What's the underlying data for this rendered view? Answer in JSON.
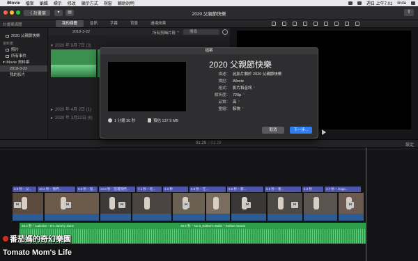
{
  "menubar": {
    "app": "iMovie",
    "items": [
      "檔案",
      "編輯",
      "標示",
      "修改",
      "顯示方式",
      "視窗",
      "輔助說明"
    ],
    "clock": "週日 上午7:01",
    "user": "linda"
  },
  "toolbar": {
    "back_label": "〈 計畫案",
    "window_title": "2020 父親節快樂"
  },
  "tabs": {
    "library_label": "計畫案媒體",
    "items": [
      "我的媒體",
      "音訊",
      "字幕",
      "背景",
      "過場效果"
    ],
    "active": "我的媒體"
  },
  "sidebar": {
    "items": [
      {
        "label": "2020 父親節快樂",
        "selected": false
      },
      {
        "label": "資料庫",
        "selected": false
      },
      {
        "label": "照片",
        "selected": false
      },
      {
        "label": "所有事件",
        "selected": false
      },
      {
        "label": "iMovie 資料庫",
        "selected": false
      },
      {
        "label": "2018-3-22",
        "selected": true
      },
      {
        "label": "我的影片",
        "selected": false
      }
    ]
  },
  "browser": {
    "current_event": "2018-3-22",
    "filter": "所有剪輯片段 ⌃",
    "search_placeholder": "搜尋",
    "events": [
      {
        "label": "2020 年 8月 7日 (3)"
      },
      {
        "label": "2020 年 4月 2日 (1)"
      },
      {
        "label": "2020 年 3月22日 (6)"
      }
    ]
  },
  "timeline": {
    "timecode": "01:29",
    "duration": "/ 01:29",
    "settings": "設定",
    "title_clips": [
      "3.9 秒 – 父...",
      "10.2 秒 – 我們...",
      "9.0 秒 – 陪...",
      "14.8 秒 – 陪著我們...",
      "7.1 秒 – 吃...",
      "4.0 秒",
      "6.8 秒 – 在...",
      "6.5 秒 – 那...",
      "5.9 秒 – 看...",
      "4.9 秒",
      "3.7 秒 – Happ..."
    ],
    "audio1": "48.2 秒 – Calimba – E's Jammy Jams",
    "audio2": "38.8 秒 – No.9_Esther's Waltz – Esther Abrami"
  },
  "dialog": {
    "title": "檔案",
    "project_name": "2020 父親節快樂",
    "rows": [
      {
        "key": "描述：",
        "value": "此影片關於 2020 父親節快樂",
        "select": false
      },
      {
        "key": "標記：",
        "value": "iMovie",
        "select": false
      },
      {
        "key": "格式：",
        "value": "影片和音訊",
        "select": true
      },
      {
        "key": "解析度：",
        "value": "720p",
        "select": true
      },
      {
        "key": "品質：",
        "value": "高",
        "select": true
      },
      {
        "key": "壓縮：",
        "value": "較快",
        "select": true
      }
    ],
    "duration": "1 分鐘 30 秒",
    "size": "預估 137.9 MB",
    "cancel_label": "取消",
    "next_label": "下一步..."
  },
  "watermark": {
    "line1": "番茄媽的奇幻樂園",
    "line2": "Tomato Mom's Life"
  }
}
